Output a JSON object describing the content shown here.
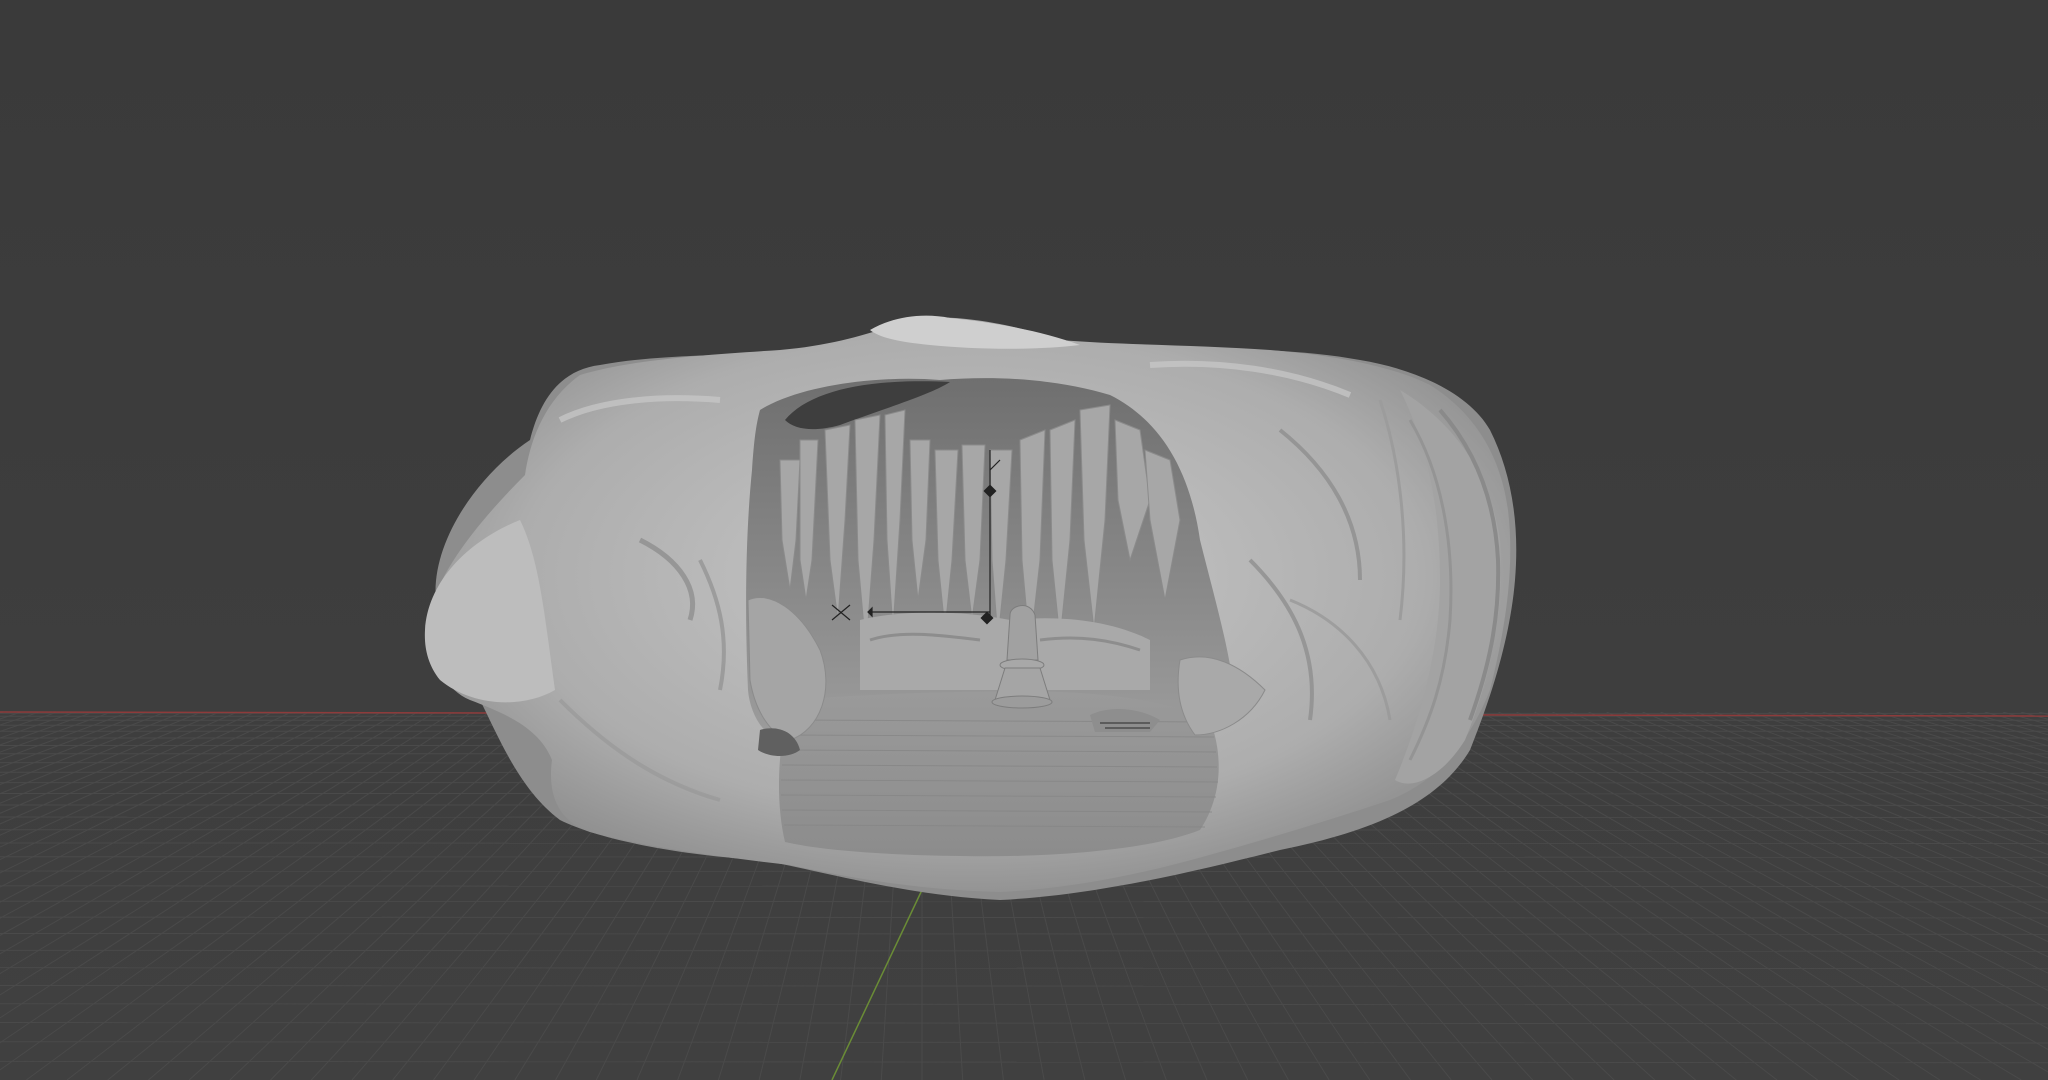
{
  "viewport": {
    "background_color": "#3d3d3d",
    "grid_color": "#4a4a4a",
    "x_axis_color": "#9a3e3e",
    "y_axis_color": "#6d8f3a",
    "mesh_color": "#b3b3b3",
    "mesh_shadow_color": "#7a7a7a",
    "mesh_highlight_color": "#cfcfcf",
    "interior_dark_color": "#555555",
    "camera_icon": "camera-icon",
    "light_icon": "light-icon"
  }
}
